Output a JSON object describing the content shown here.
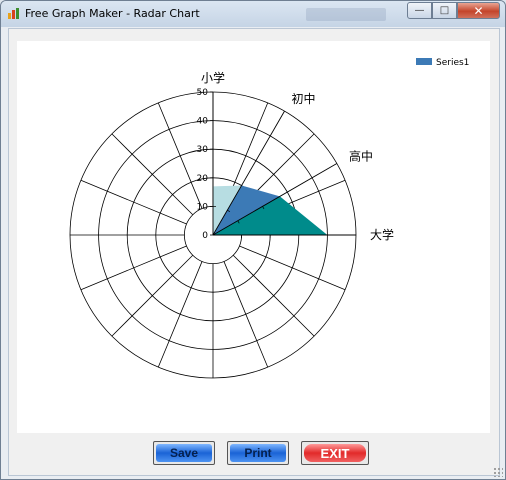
{
  "window": {
    "title": "Free Graph Maker - Radar Chart"
  },
  "buttons": {
    "save": "Save",
    "print": "Print",
    "exit": "EXIT"
  },
  "chart_data": {
    "type": "radar",
    "title": "",
    "categories": [
      "小学",
      "初中",
      "高中",
      "大学"
    ],
    "radial_ticks": [
      0,
      10,
      20,
      30,
      40,
      50
    ],
    "rlim": [
      0,
      50
    ],
    "series": [
      {
        "name": "Series1",
        "values": [
          17,
          20,
          27,
          40
        ],
        "color": "#3c7ab6"
      }
    ],
    "legend": {
      "placement": "top-right"
    },
    "grid": true
  },
  "colors": {
    "series1": "#3c7ab6",
    "fill_band_1": "#b7dde2",
    "fill_band_2": "#008b8b",
    "save_button": "#1a63d6",
    "exit_button": "#e22a2a"
  }
}
